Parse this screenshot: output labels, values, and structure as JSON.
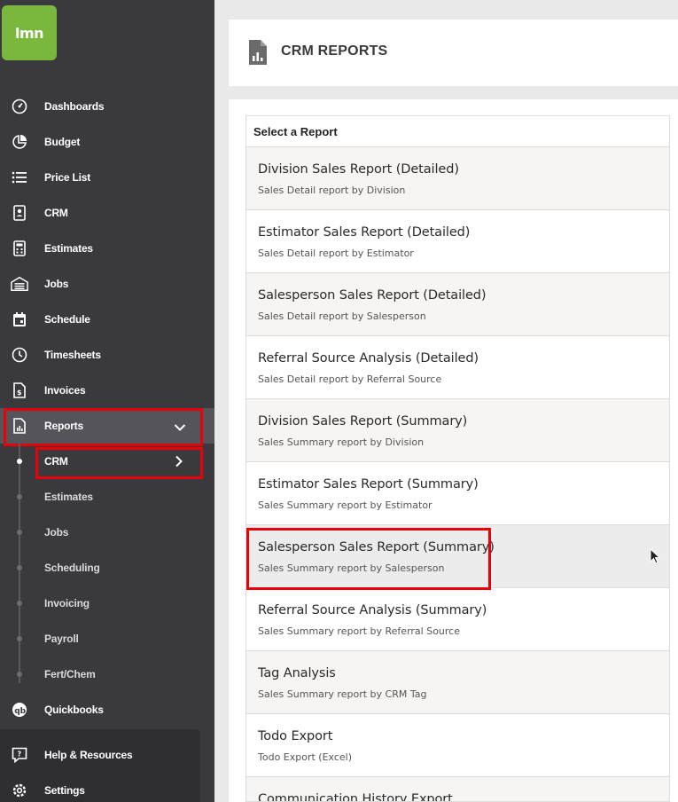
{
  "logo": {
    "text": "lmn"
  },
  "sidebar": {
    "items": [
      {
        "label": "Dashboards",
        "icon": "gauge-icon"
      },
      {
        "label": "Budget",
        "icon": "pie-chart-icon"
      },
      {
        "label": "Price List",
        "icon": "list-icon"
      },
      {
        "label": "CRM",
        "icon": "contact-card-icon"
      },
      {
        "label": "Estimates",
        "icon": "calculator-icon"
      },
      {
        "label": "Jobs",
        "icon": "garage-icon"
      },
      {
        "label": "Schedule",
        "icon": "calendar-icon"
      },
      {
        "label": "Timesheets",
        "icon": "clock-icon"
      },
      {
        "label": "Invoices",
        "icon": "invoice-icon"
      },
      {
        "label": "Reports",
        "icon": "report-icon"
      }
    ],
    "report_sub": [
      {
        "label": "CRM"
      },
      {
        "label": "Estimates"
      },
      {
        "label": "Jobs"
      },
      {
        "label": "Scheduling"
      },
      {
        "label": "Invoicing"
      },
      {
        "label": "Payroll"
      },
      {
        "label": "Fert/Chem"
      }
    ],
    "quickbooks": "Quickbooks",
    "help": "Help & Resources",
    "settings": "Settings"
  },
  "header": {
    "title": "CRM REPORTS"
  },
  "reports": {
    "header": "Select a Report",
    "items": [
      {
        "title": "Division Sales Report (Detailed)",
        "sub": "Sales Detail report by Division"
      },
      {
        "title": "Estimator Sales Report (Detailed)",
        "sub": "Sales Detail report by Estimator"
      },
      {
        "title": "Salesperson Sales Report (Detailed)",
        "sub": "Sales Detail report by Salesperson"
      },
      {
        "title": "Referral Source Analysis (Detailed)",
        "sub": "Sales Detail report by Referral Source"
      },
      {
        "title": "Division Sales Report (Summary)",
        "sub": "Sales Summary report by Division"
      },
      {
        "title": "Estimator Sales Report (Summary)",
        "sub": "Sales Summary report by Estimator"
      },
      {
        "title": "Salesperson Sales Report (Summary)",
        "sub": "Sales Summary report by Salesperson"
      },
      {
        "title": "Referral Source Analysis (Summary)",
        "sub": "Sales Summary report by Referral Source"
      },
      {
        "title": "Tag Analysis",
        "sub": "Sales Summary report by CRM Tag"
      },
      {
        "title": "Todo Export",
        "sub": "Todo Export (Excel)"
      },
      {
        "title": "Communication History Export",
        "sub": ""
      }
    ]
  },
  "colors": {
    "sidebar": "#3a3a3e",
    "brand": "#79b83d",
    "highlight": "#e8000b"
  }
}
